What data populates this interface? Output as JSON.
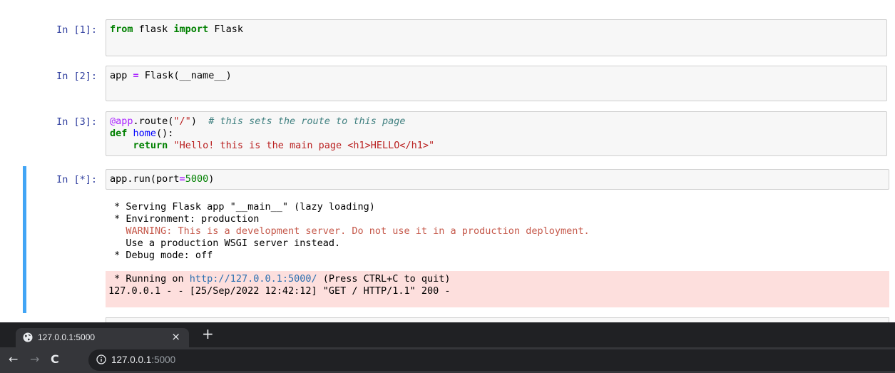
{
  "notebook": {
    "cells": [
      {
        "prompt": "In [1]:",
        "code_line1": [
          "from",
          " flask ",
          "import",
          " Flask"
        ]
      },
      {
        "prompt": "In [2]:",
        "code_line1": [
          "app ",
          "=",
          " Flask(__name__)"
        ]
      },
      {
        "prompt": "In [3]:",
        "code_line1": [
          "@app",
          ".route(",
          "\"/\"",
          ")  ",
          "# this sets the route to this page"
        ],
        "code_line2": [
          "def",
          " ",
          "home",
          "():"
        ],
        "code_line3": [
          "    ",
          "return",
          " ",
          "\"Hello! this is the main page <h1>HELLO</h1>\""
        ]
      },
      {
        "prompt": "In [*]:",
        "code_line1": [
          "app.run(port",
          "=",
          "5000",
          ")"
        ]
      }
    ],
    "stderr_output": {
      "line1": " * Serving Flask app \"__main__\" (lazy loading)",
      "line2": " * Environment: production",
      "line3": "   WARNING: This is a development server. Do not use it in a production deployment.",
      "line4": "   Use a production WSGI server instead.",
      "line5": " * Debug mode: off"
    },
    "stderr_output2": {
      "line1_prefix": " * Running on ",
      "line1_link": "http://127.0.0.1:5000/",
      "line1_suffix": " (Press CTRL+C to quit)",
      "line2": "127.0.0.1 - - [25/Sep/2022 12:42:12] \"GET / HTTP/1.1\" 200 -"
    }
  },
  "browser": {
    "tab_title": "127.0.0.1:5000",
    "tab_close": "×",
    "new_tab": "+",
    "back": "←",
    "forward": "→",
    "reload": "C",
    "url_host": "127.0.0.1",
    "url_port": ":5000",
    "icons": [
      "globe-icon",
      "info-icon"
    ],
    "colors": {
      "tabbar": "#202124",
      "toolbar": "#35363a",
      "cell_selected": "#42a5f5",
      "stderr_bg": "#fddfdd"
    }
  }
}
